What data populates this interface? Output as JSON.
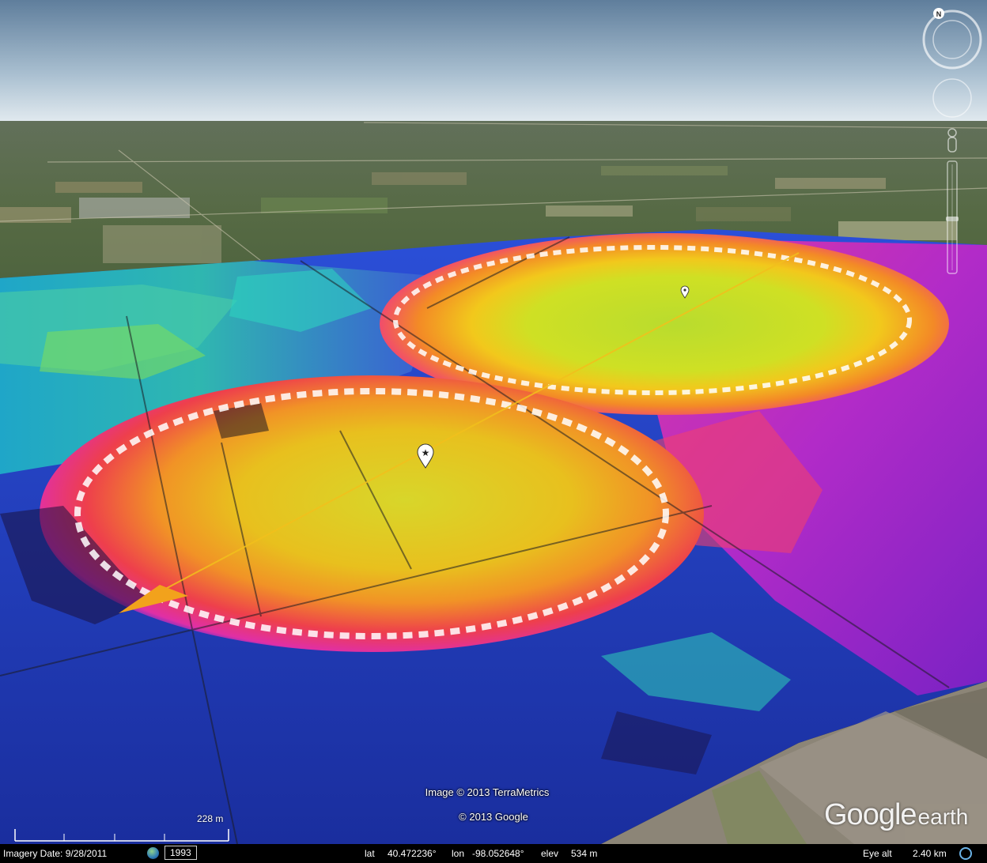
{
  "credits": {
    "imagery": "Image © 2013 TerraMetrics",
    "google": "© 2013 Google"
  },
  "logo": {
    "google": "Google",
    "earth": "earth"
  },
  "scale": {
    "label": "228 m"
  },
  "status": {
    "imagery_date": "Imagery Date: 9/28/2011",
    "history_year": "1993",
    "lat_label": "lat",
    "lat": "40.472236°",
    "lon_label": "lon",
    "lon": "-98.052648°",
    "elev_label": "elev",
    "elev": "534 m",
    "eye_label": "Eye alt",
    "eye_alt": "2.40 km"
  },
  "compass": {
    "north_label": "N"
  },
  "icons": {
    "placemark_star": "star-placemark-icon",
    "placemark_plain": "placemark-icon",
    "history": "clock-history-icon",
    "streaming": "streaming-status-icon"
  },
  "colors": {
    "sky_top": "#5f7e9c",
    "sky_bottom": "#dde6ec",
    "fields": "#4e5f3a",
    "path_arrow": "#f2a21c"
  }
}
